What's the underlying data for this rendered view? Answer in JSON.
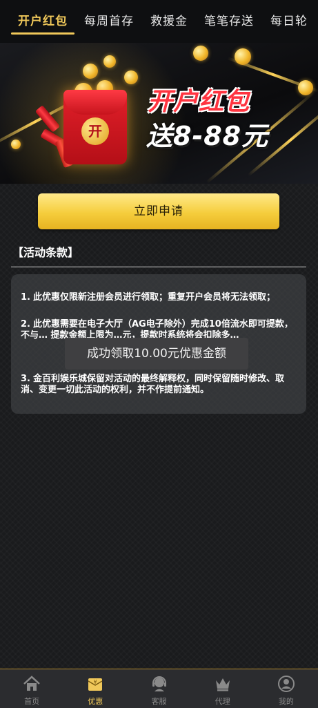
{
  "tabs": [
    "开户红包",
    "每周首存",
    "救援金",
    "笔笔存送",
    "每日轮"
  ],
  "banner": {
    "title": "开户红包",
    "subtitle": "送8-88元",
    "envelope_char": "开"
  },
  "apply_button": "立即申请",
  "terms": {
    "title": "【活动条款】",
    "items": [
      {
        "num": "1.",
        "text": "此优惠仅限新注册会员进行领取；重复开户会员将无法领取；"
      },
      {
        "num": "2.",
        "text": "此优惠需要在电子大厅（AG电子除外）完成10倍流水即可提款，不与… 提款金额上限为…元，提款时系统将会扣除多…"
      },
      {
        "num": "3.",
        "text": "金百利娱乐城保留对活动的最终解释权，同时保留随时修改、取消、变更一切此活动的权利，并不作提前通知。"
      }
    ]
  },
  "toast": "成功领取10.00元优惠金额",
  "bottom_nav": [
    {
      "label": "首页",
      "icon": "home-icon"
    },
    {
      "label": "优惠",
      "icon": "gift-icon"
    },
    {
      "label": "客服",
      "icon": "support-icon"
    },
    {
      "label": "代理",
      "icon": "crown-icon"
    },
    {
      "label": "我的",
      "icon": "user-icon"
    }
  ],
  "colors": {
    "accent": "#f0c85a",
    "button_top": "#ffe98a",
    "button_bottom": "#e6b321",
    "background": "#1a1b1d"
  }
}
